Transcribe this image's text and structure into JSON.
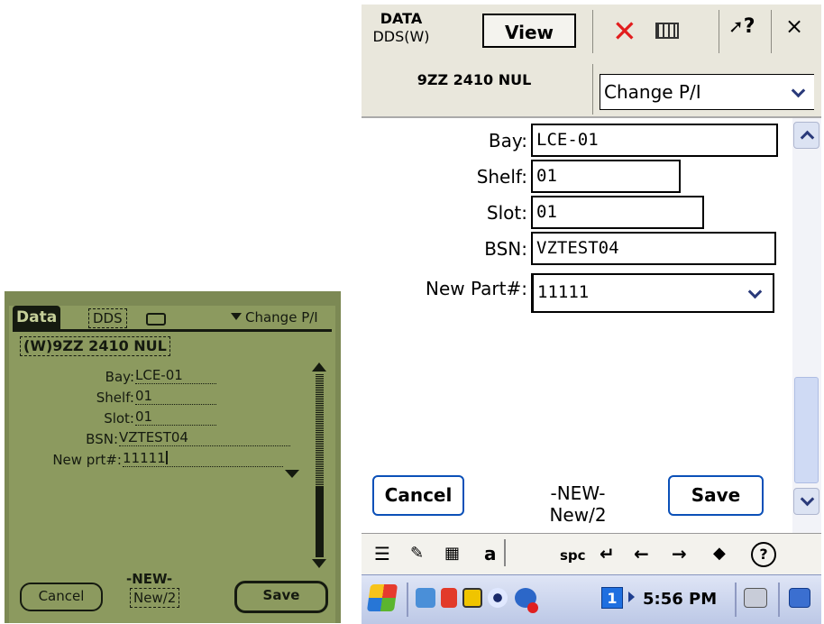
{
  "palm": {
    "tab_data": "Data",
    "tab_dds": "DDS",
    "battery_icon": "battery-icon",
    "category": "Change P/I",
    "record_title": "(W)9ZZ 2410 NUL",
    "fields": [
      {
        "label": "Bay:",
        "value": "LCE-01"
      },
      {
        "label": "Shelf:",
        "value": "01"
      },
      {
        "label": "Slot:",
        "value": "01"
      },
      {
        "label": "BSN:",
        "value": "VZTEST04"
      },
      {
        "label": "New prt#:",
        "value": "11111"
      }
    ],
    "cancel_label": "Cancel",
    "save_label": "Save",
    "new_label": "-NEW-",
    "new_count": "New/2"
  },
  "wm": {
    "title_line1": "DATA",
    "title_line2": "DDS(W)",
    "view_label": "View",
    "close_label": "×",
    "help_label": "?",
    "record_title": "9ZZ 2410 NUL",
    "category": "Change P/I",
    "fields": [
      {
        "label": "Bay:",
        "value": "LCE-01"
      },
      {
        "label": "Shelf:",
        "value": "01"
      },
      {
        "label": "Slot:",
        "value": "01"
      },
      {
        "label": "BSN:",
        "value": "VZTEST04"
      },
      {
        "label": "New Part#:",
        "value": "11111"
      }
    ],
    "cancel_label": "Cancel",
    "save_label": "Save",
    "new_label": "-NEW-",
    "new_count": "New/2",
    "sip": {
      "list": "☰",
      "a": "a",
      "spc": "spc",
      "enter": "↵",
      "left": "←",
      "right": "→",
      "bksp": "◆",
      "help": "?"
    },
    "taskbar": {
      "clock": "5:56 PM",
      "badge": "1"
    }
  }
}
